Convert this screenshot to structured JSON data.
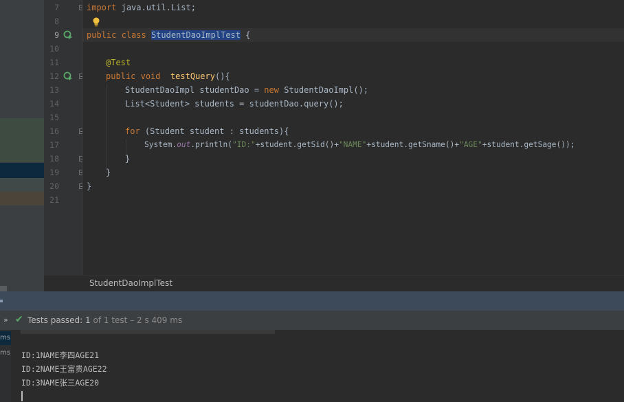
{
  "editor": {
    "line_numbers": [
      "7",
      "8",
      "9",
      "10",
      "11",
      "12",
      "13",
      "14",
      "15",
      "16",
      "17",
      "18",
      "19",
      "20",
      "21"
    ],
    "import_kw": "import",
    "import_path": "java.util.List;",
    "class_decl": {
      "kw1": "public",
      "kw2": "class",
      "name": "StudentDaoImplTest",
      "brace": "{"
    },
    "annotation": "@Test",
    "method_decl": {
      "kw1": "public",
      "kw2": "void",
      "name": "testQuery",
      "rest": "(){"
    },
    "line13": {
      "type": "StudentDaoImpl studentDao = ",
      "kw": "new",
      "rest": " StudentDaoImpl();"
    },
    "line14": "List<Student> students = studentDao.query();",
    "for_line": {
      "kw": "for",
      "rest": " (Student student : students){"
    },
    "println": {
      "p1": "System.",
      "field": "out",
      "p2": ".println(",
      "s1": "\"ID:\"",
      "p3": "+student.getSid()+",
      "s2": "\"NAME\"",
      "p4": "+student.getSname()+",
      "s3": "\"AGE\"",
      "p5": "+student.getSage());"
    },
    "close_brace": "}"
  },
  "breadcrumb": "StudentDaoImplTest",
  "run": {
    "chevron": "»",
    "status_label": "Tests passed:",
    "status_count": "1",
    "status_detail": "of 1 test – 2 s 409 ms",
    "side_items": [
      "ms",
      "ms"
    ],
    "output_lines": [
      "ID:1NAME李四AGE21",
      "ID:2NAME王富贵AGE22",
      "ID:3NAME张三AGE20"
    ]
  },
  "colors": {
    "keyword": "#cc7832",
    "annotation": "#bbb529",
    "method": "#ffc66d",
    "string": "#6a8759",
    "success": "#59a869"
  }
}
